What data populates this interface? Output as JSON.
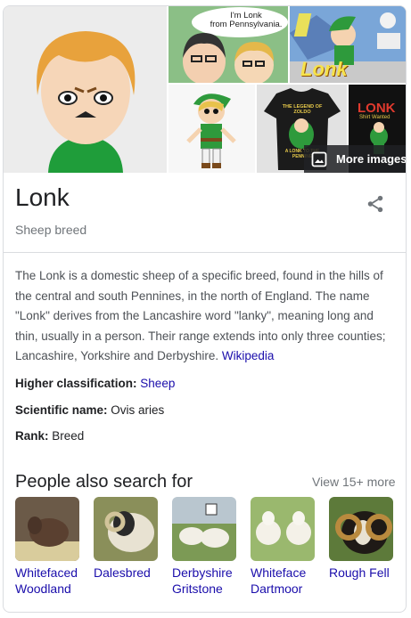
{
  "images": {
    "more_images_label": "More images",
    "caption_tl": "I'm Lonk\nfrom Pennsylvania.",
    "caption_tr": "Lonk",
    "shirt_text": "THE LEGEND OF ZOLDO",
    "shirt_bottom": "A LONK TO THE PENNINE",
    "br_text": "LONK",
    "br_sub": "Shirt Wanted"
  },
  "entity": {
    "title": "Lonk",
    "subtitle": "Sheep breed"
  },
  "description": {
    "text": "The Lonk is a domestic sheep of a specific breed, found in the hills of the central and south Pennines, in the north of England. The name \"Lonk\" derives from the Lancashire word \"lanky\", meaning long and thin, usually in a person. Their range extends into only three counties; Lancashire, Yorkshire and Derbyshire. ",
    "source": "Wikipedia"
  },
  "facts": [
    {
      "label": "Higher classification: ",
      "value": "Sheep",
      "is_link": true
    },
    {
      "label": "Scientific name: ",
      "value": "Ovis aries",
      "is_link": false
    },
    {
      "label": "Rank: ",
      "value": "Breed",
      "is_link": false
    }
  ],
  "people_also_search": {
    "title": "People also search for",
    "view_more": "View 15+ more",
    "items": [
      {
        "line1": "Whitefaced",
        "line2": "Woodland"
      },
      {
        "line1": "Dalesbred",
        "line2": ""
      },
      {
        "line1": "Derbyshire",
        "line2": "Gritstone"
      },
      {
        "line1": "Whiteface",
        "line2": "Dartmoor"
      },
      {
        "line1": "Rough Fell",
        "line2": ""
      }
    ]
  },
  "icons": {
    "share": "share-icon",
    "more_images": "image-icon"
  },
  "colors": {
    "link": "#1a0dab",
    "muted": "#70757a",
    "border": "#dadce0",
    "text": "#202124"
  }
}
